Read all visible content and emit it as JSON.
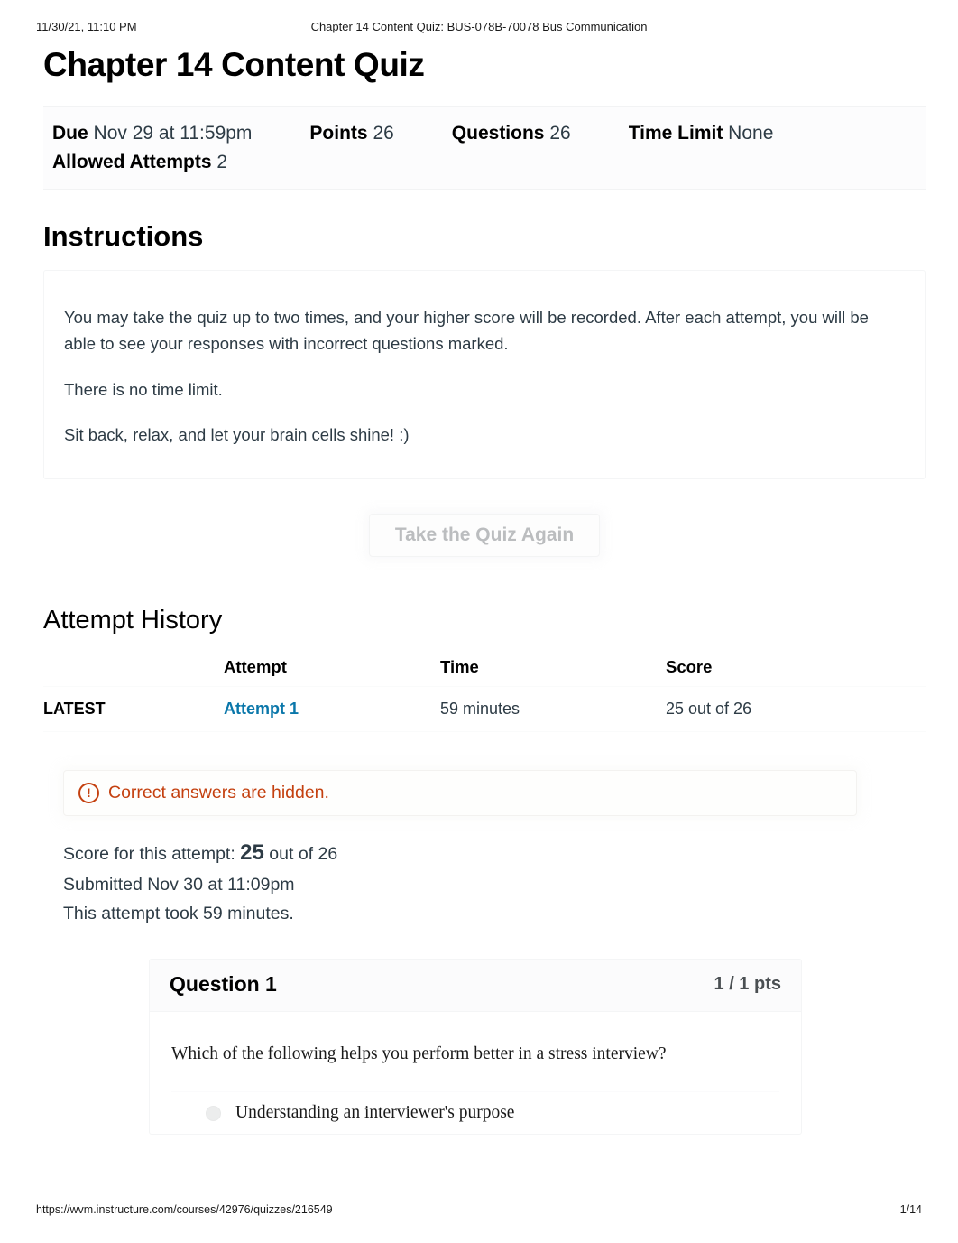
{
  "print": {
    "date": "11/30/21, 11:10 PM",
    "doc_title": "Chapter 14 Content Quiz: BUS-078B-70078 Bus Communication",
    "url": "https://wvm.instructure.com/courses/42976/quizzes/216549",
    "page_number": "1/14"
  },
  "quiz": {
    "title": "Chapter 14 Content Quiz",
    "meta": [
      {
        "label": "Due",
        "value": "Nov 29 at 11:59pm"
      },
      {
        "label": "Points",
        "value": "26"
      },
      {
        "label": "Questions",
        "value": "26"
      },
      {
        "label": "Time Limit",
        "value": "None"
      },
      {
        "label": "Allowed Attempts",
        "value": "2"
      }
    ]
  },
  "instructions": {
    "heading": "Instructions",
    "paragraphs": [
      "You may take the quiz up to two times, and your higher score will be recorded. After each attempt, you will be able to see your responses with incorrect questions marked.",
      "There is no time limit.",
      "Sit back, relax, and let your brain cells shine! :)"
    ]
  },
  "actions": {
    "take_again_label": "Take the Quiz Again"
  },
  "attempt_history": {
    "heading": "Attempt History",
    "columns": [
      "",
      "Attempt",
      "Time",
      "Score"
    ],
    "rows": [
      {
        "latest": "LATEST",
        "attempt": "Attempt 1",
        "time": "59 minutes",
        "score": "25 out of 26"
      }
    ]
  },
  "results": {
    "alert": {
      "icon": "exclamation-circle-icon",
      "icon_glyph": "!",
      "text": "Correct answers are hidden.",
      "color": "#c4400f"
    },
    "score_prefix": "Score for this attempt:",
    "score_value": "25",
    "score_suffix": "out of 26",
    "submitted": "Submitted Nov 30 at 11:09pm",
    "duration": "This attempt took 59 minutes."
  },
  "question": {
    "name": "Question 1",
    "points": "1 / 1 pts",
    "text": "Which of the following helps you perform better in a stress interview?",
    "answers": [
      {
        "text": "Understanding an interviewer's purpose"
      }
    ]
  },
  "colors": {
    "link": "#0a77aa",
    "alert": "#c4400f",
    "text": "#2d3b45"
  }
}
